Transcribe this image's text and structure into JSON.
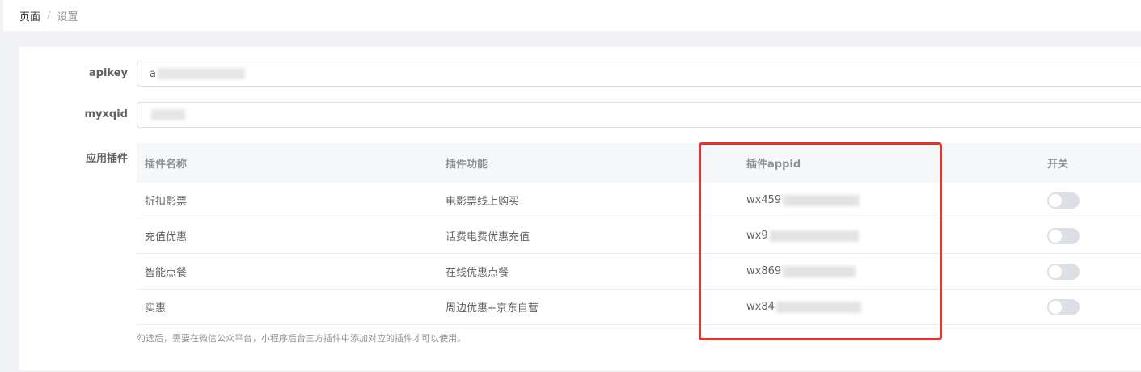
{
  "breadcrumb": {
    "home": "页面",
    "separator": "/",
    "current": "设置"
  },
  "form": {
    "apikey_label": "apikey",
    "apikey_value": "a",
    "myxqid_label": "myxqid",
    "myxqid_value": "",
    "plugins_label": "应用插件"
  },
  "table": {
    "headers": [
      "插件名称",
      "插件功能",
      "插件appid",
      "开关"
    ],
    "rows": [
      {
        "name": "折扣影票",
        "feature": "电影票线上购买",
        "appid": "wx459",
        "enabled": false
      },
      {
        "name": "充值优惠",
        "feature": "话费电费优惠充值",
        "appid": "wx9",
        "enabled": false
      },
      {
        "name": "智能点餐",
        "feature": "在线优惠点餐",
        "appid": "wx869",
        "enabled": false
      },
      {
        "name": "实惠",
        "feature": "周边优惠+京东自营",
        "appid": "wx84",
        "enabled": false
      }
    ]
  },
  "hint": "勾选后，需要在微信公众平台，小程序后台三方插件中添加对应的插件才可以使用。",
  "colors": {
    "highlight": "#e8322b",
    "switch_off": "#dcdfe6"
  }
}
